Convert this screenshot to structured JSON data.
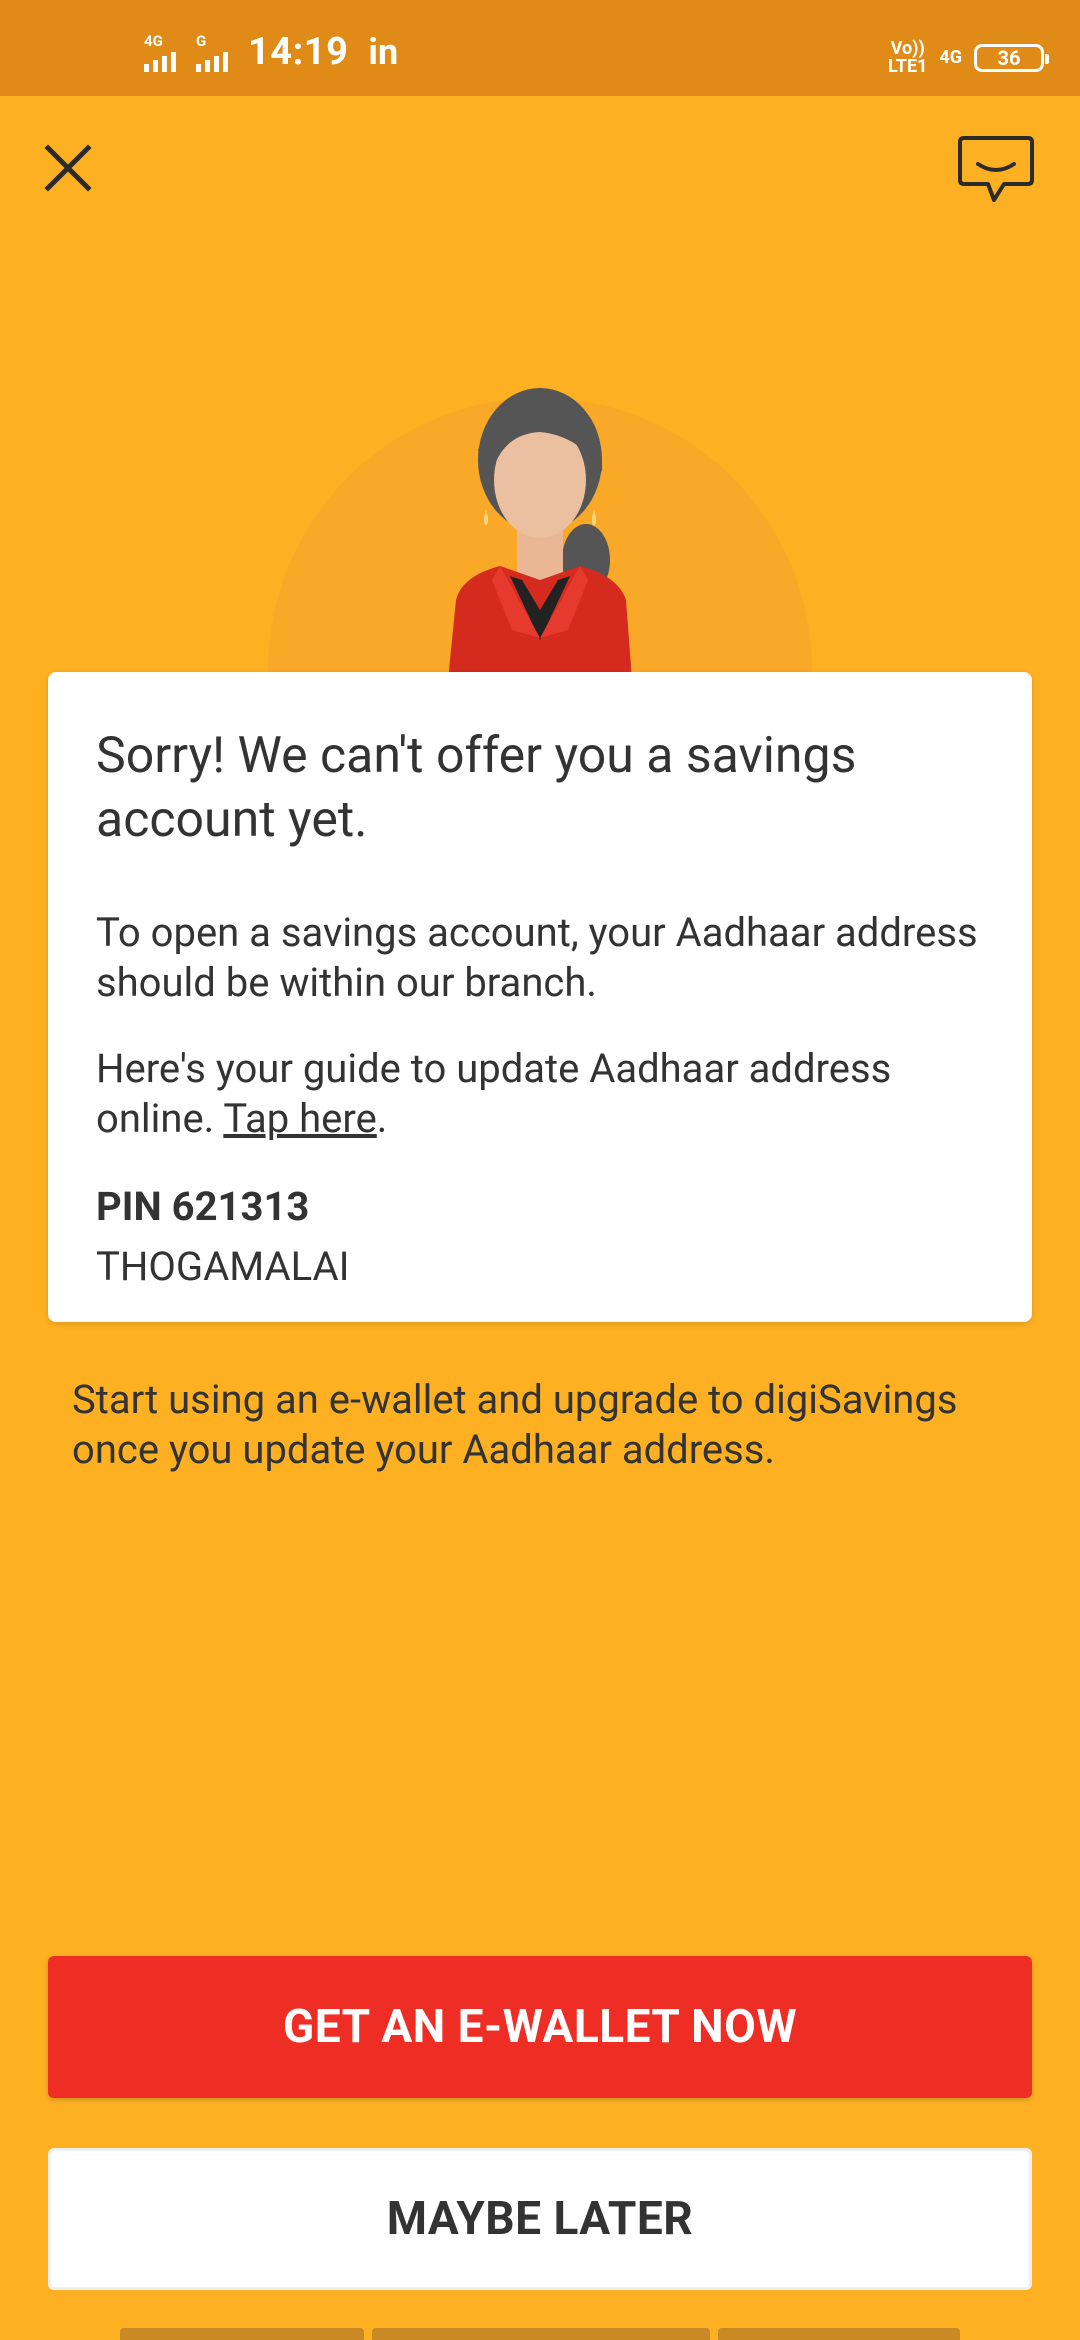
{
  "status_bar": {
    "sim1_label": "4G",
    "sim2_label": "G",
    "time": "14:19",
    "carrier_icon_text": "in",
    "volte_label": "Vo))\nLTE1",
    "network_label": "4G",
    "battery": "36"
  },
  "header": {
    "close_icon": "close-icon",
    "chat_icon": "chat-icon"
  },
  "card": {
    "title": "Sorry! We can't offer you a savings account yet.",
    "paragraph_1": "To open a savings account, your Aadhaar address should be within our branch.",
    "paragraph_2_prefix": "Here's your guide to update Aadhaar address online. ",
    "link_text": "Tap here",
    "paragraph_2_suffix": ".",
    "pin": "PIN 621313",
    "city": "THOGAMALAI"
  },
  "subtext": "Start using an e-wallet and upgrade to digiSavings once you update your Aadhaar address.",
  "buttons": {
    "primary": "GET AN E-WALLET NOW",
    "secondary": "MAYBE LATER"
  },
  "colors": {
    "background": "#FDB022",
    "status_bar": "#E08B17",
    "primary_button": "#EE2E24"
  }
}
